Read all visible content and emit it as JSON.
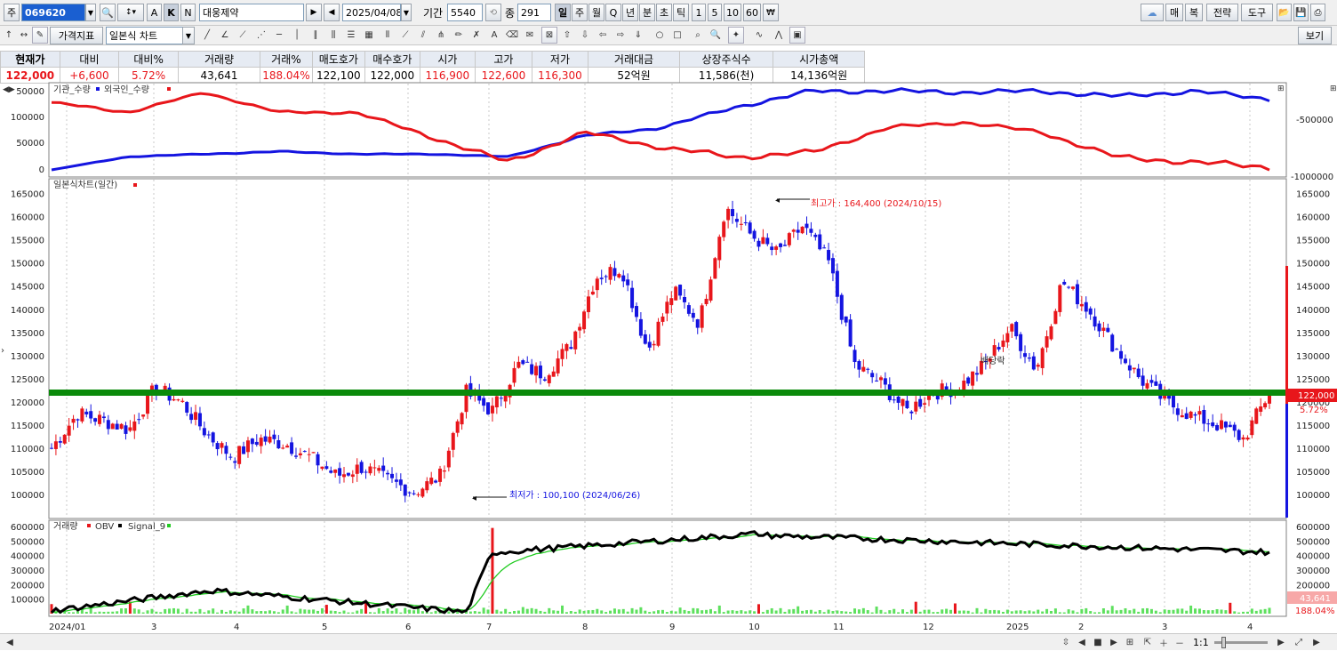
{
  "toolbar1": {
    "market": "주",
    "code": "069620",
    "mode_a": "A",
    "mode_k": "K",
    "mode_n": "N",
    "stock_name": "대웅제약",
    "date": "2025/04/08",
    "period_label": "기간",
    "period_value": "5540",
    "count_label": "종",
    "count_value": "291",
    "periods": [
      "일",
      "주",
      "월",
      "Q",
      "년",
      "분",
      "초",
      "틱",
      "1",
      "5",
      "10",
      "60"
    ],
    "right_buttons": [
      "매",
      "복",
      "전략",
      "도구"
    ]
  },
  "toolbar2": {
    "price_indicator": "가격지표",
    "chart_type": "일본식 차트",
    "view": "보기"
  },
  "quote": {
    "headers": [
      "현재가",
      "대비",
      "대비%",
      "거래량",
      "거래%",
      "매도호가",
      "매수호가",
      "시가",
      "고가",
      "저가",
      "거래대금",
      "상장주식수",
      "시가총액"
    ],
    "values": [
      "122,000",
      "+6,600",
      "5.72%",
      "43,641",
      "188.04%",
      "122,100",
      "122,000",
      "116,900",
      "122,600",
      "116,300",
      "52억원",
      "11,586(천)",
      "14,136억원"
    ]
  },
  "panel_top": {
    "legend_a": "기관_수량",
    "legend_b": "외국인_수량",
    "left_ticks": [
      "50000",
      "100000",
      "50000",
      "0"
    ],
    "right_ticks": [
      "-500000",
      "-1000000"
    ]
  },
  "panel_main": {
    "title": "일본식차트(일간)",
    "ticks": [
      "165000",
      "160000",
      "155000",
      "150000",
      "145000",
      "140000",
      "135000",
      "130000",
      "125000",
      "120000",
      "115000",
      "110000",
      "105000",
      "100000"
    ],
    "high_note": "최고가 : 164,400 (2024/10/15)",
    "low_note": "최저가 : 100,100 (2024/06/26)",
    "dividend_note": "배당락",
    "price_tag": "122,000",
    "pct_tag": "5.72%"
  },
  "panel_vol": {
    "title": "거래량",
    "legend_obv": "OBV",
    "legend_signal": "Signal_9",
    "ticks": [
      "600000",
      "500000",
      "400000",
      "300000",
      "200000",
      "100000"
    ],
    "vol_tag": "43,641",
    "pct_tag": "188.04%"
  },
  "xaxis": [
    "2024/01",
    "3",
    "4",
    "5",
    "6",
    "7",
    "8",
    "9",
    "10",
    "11",
    "12",
    "2025",
    "2",
    "3",
    "4"
  ],
  "statusbar": {
    "ratio": "1:1"
  },
  "colors": {
    "up": "#e8161b",
    "down": "#1414e0",
    "foreign": "#e8161b",
    "institution": "#1414e0",
    "support": "#0a8a0a",
    "obv": "#000000",
    "signal": "#22cc22"
  },
  "chart_data": [
    {
      "type": "line",
      "series": [
        {
          "name": "기관_수량",
          "values": [
            0,
            25000,
            30000,
            35000,
            30000,
            30000,
            25000,
            65000,
            80000,
            120000,
            150000,
            150000,
            148000,
            150000,
            140000,
            150000,
            135000
          ]
        },
        {
          "name": "외국인_수량",
          "values": [
            -350000,
            -450000,
            -250000,
            -450000,
            -450000,
            -700000,
            -950000,
            -650000,
            -800000,
            -900000,
            -850000,
            -600000,
            -550000,
            -650000,
            -900000,
            -950000,
            -1000000
          ]
        }
      ]
    },
    {
      "type": "candlestick",
      "ylim": [
        95000,
        168000
      ],
      "high": {
        "value": 164400,
        "date": "2024/10/15"
      },
      "low": {
        "value": 100100,
        "date": "2024/06/26"
      },
      "support": 122000,
      "last": {
        "open": 116900,
        "high": 122600,
        "low": 116300,
        "close": 122000
      },
      "closes": [
        110000,
        117500,
        116000,
        114000,
        123000,
        120000,
        113000,
        108000,
        112000,
        111000,
        108000,
        104000,
        106000,
        103000,
        100500,
        104000,
        122000,
        118000,
        128000,
        126000,
        132000,
        147000,
        149000,
        131000,
        144000,
        137000,
        162000,
        156000,
        152000,
        158000,
        150000,
        128000,
        124000,
        118000,
        122000,
        123000,
        128000,
        136000,
        127000,
        146000,
        140000,
        132000,
        125000,
        120000,
        117000,
        115000,
        112000,
        122000
      ]
    },
    {
      "type": "bar",
      "ylim": [
        0,
        600000
      ],
      "obv_start": 20000,
      "last_volume": 43641
    }
  ]
}
